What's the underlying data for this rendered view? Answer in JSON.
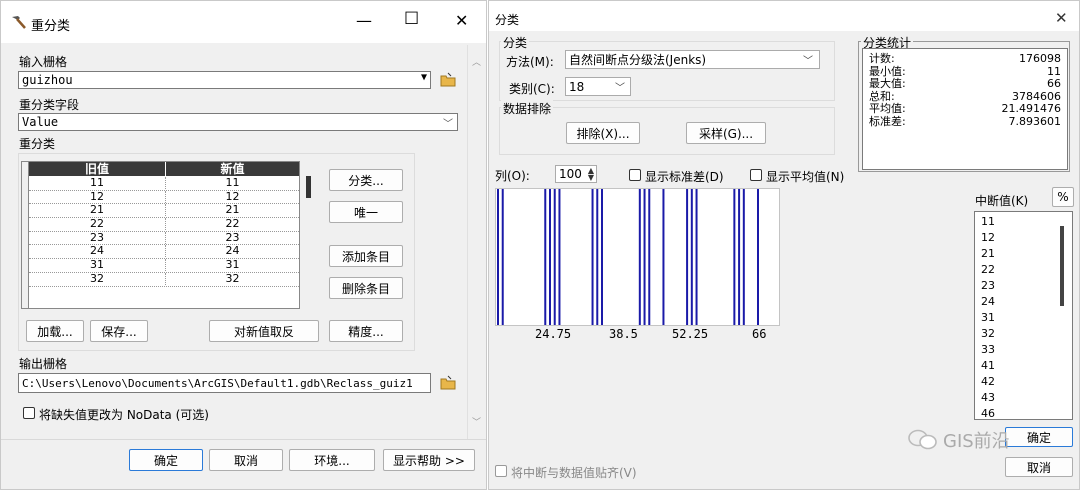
{
  "left_window": {
    "title": "重分类",
    "controls": {
      "minimize": "—",
      "maximize": "☐",
      "close": "✕"
    },
    "input_raster_label": "输入栅格",
    "input_raster_value": "guizhou",
    "reclass_field_label": "重分类字段",
    "reclass_field_value": "Value",
    "reclassification_label": "重分类",
    "table_headers": [
      "旧值",
      "新值"
    ],
    "table_rows": [
      [
        "11",
        "11"
      ],
      [
        "12",
        "12"
      ],
      [
        "21",
        "21"
      ],
      [
        "22",
        "22"
      ],
      [
        "23",
        "23"
      ],
      [
        "24",
        "24"
      ],
      [
        "31",
        "31"
      ],
      [
        "32",
        "32"
      ]
    ],
    "side_buttons": {
      "classify": "分类...",
      "unique": "唯一",
      "add_entry": "添加条目",
      "delete_entry": "删除条目",
      "precision": "精度..."
    },
    "bottom_table_buttons": {
      "load": "加载...",
      "save": "保存...",
      "reverse": "对新值取反"
    },
    "output_raster_label": "输出栅格",
    "output_raster_value": "C:\\Users\\Lenovo\\Documents\\ArcGIS\\Default1.gdb\\Reclass_guiz1",
    "nodata_checkbox_label": "将缺失值更改为 NoData (可选)",
    "footer_buttons": {
      "ok": "确定",
      "cancel": "取消",
      "env": "环境...",
      "help": "显示帮助 >>"
    }
  },
  "right_window": {
    "title": "分类",
    "close": "✕",
    "classification_group": "分类",
    "method_label": "方法(M):",
    "method_value": "自然间断点分级法(Jenks)",
    "classes_label": "类别(C):",
    "classes_value": "18",
    "exclusion_group": "数据排除",
    "exclusion_button": "排除(X)...",
    "sampling_button": "采样(G)...",
    "stats_group": "分类统计",
    "stats": [
      {
        "label": "计数:",
        "value": "176098"
      },
      {
        "label": "最小值:",
        "value": "11"
      },
      {
        "label": "最大值:",
        "value": "66"
      },
      {
        "label": "总和:",
        "value": "3784606"
      },
      {
        "label": "平均值:",
        "value": "21.491476"
      },
      {
        "label": "标准差:",
        "value": "7.893601"
      }
    ],
    "columns_label": "列(O):",
    "columns_value": "100",
    "show_std_label": "显示标准差(D)",
    "show_mean_label": "显示平均值(N)",
    "x_ticks": [
      "24.75",
      "38.5",
      "52.25",
      "66"
    ],
    "breaks_label": "中断值(K)",
    "percent_button": "%",
    "break_values": [
      "11",
      "12",
      "21",
      "22",
      "23",
      "24",
      "31",
      "32",
      "33",
      "41",
      "42",
      "43",
      "46"
    ],
    "snap_label": "将中断与数据值贴齐(V)",
    "ok_button": "确定",
    "cancel_button": "取消",
    "watermark": "GIS前沿"
  }
}
